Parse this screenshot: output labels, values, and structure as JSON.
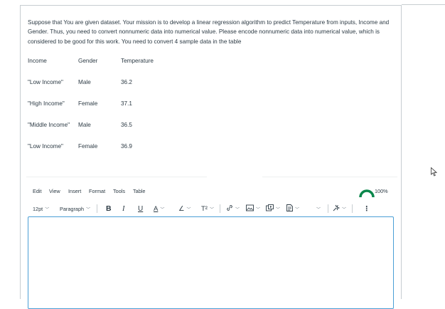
{
  "question": {
    "text": "Suppose that You are given dataset. Your mission is to develop a linear regression algorithm to predict Temperature from inputs, Income and Gender. Thus, you need to convert nonnumeric data into numerical value. Please encode nonnumeric data into numerical value, which is considered to be good for this work. You need to convert 4 sample data in the table"
  },
  "table": {
    "headers": [
      "Income",
      "Gender",
      "Temperature"
    ],
    "rows": [
      [
        "\"Low Income\"",
        "Male",
        "36.2"
      ],
      [
        "\"High Income\"",
        "Female",
        "37.1"
      ],
      [
        "\"Middle Income\"",
        "Male",
        "36.5"
      ],
      [
        "\"Low Income\"",
        "Female",
        "36.9"
      ]
    ]
  },
  "editor": {
    "menu": [
      "Edit",
      "View",
      "Insert",
      "Format",
      "Tools",
      "Table"
    ],
    "zoom": "100%",
    "font_size": "12pt",
    "block_format": "Paragraph",
    "bold": "B",
    "italic": "I",
    "underline": "U",
    "text_color": "A",
    "highlight": "∠",
    "superscript": "T²",
    "more": "⋮",
    "value": ""
  },
  "icons": [
    "chevron-down-icon",
    "link-icon",
    "image-icon",
    "media-icon",
    "document-icon",
    "lti-plugin-icon",
    "more-icon",
    "accessibility-gauge-icon",
    "mouse-pointer-icon"
  ],
  "colors": {
    "text": "#2d3b45",
    "editor_focus_border": "#4a9fd6",
    "gauge": "#0b874b"
  }
}
